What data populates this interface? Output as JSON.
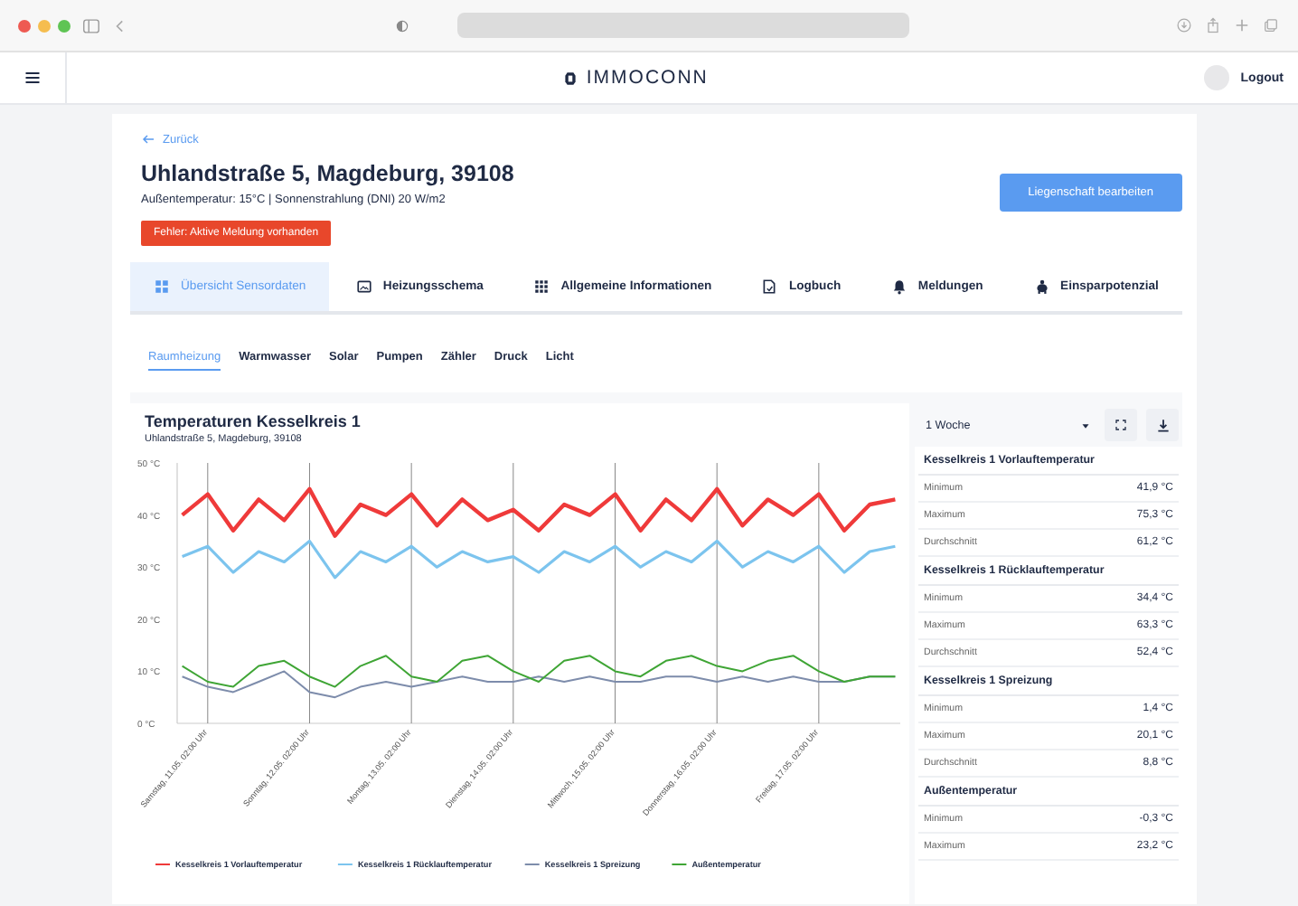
{
  "app": {
    "logo_text": "IMMOCONN",
    "logout": "Logout"
  },
  "page": {
    "back": "Zurück",
    "title": "Uhlandstraße 5, Magdeburg, 39108",
    "subtitle": "Außentemperatur: 15°C | Sonnenstrahlung (DNI) 20 W/m2",
    "alert": "Fehler: Aktive Meldung vorhanden",
    "edit_button": "Liegenschaft bearbeiten"
  },
  "tabs": [
    {
      "label": "Übersicht Sensordaten",
      "kind": "grid",
      "selected": true
    },
    {
      "label": "Heizungsschema",
      "kind": "image",
      "selected": false
    },
    {
      "label": "Allgemeine Informationen",
      "kind": "dots",
      "selected": false
    },
    {
      "label": "Logbuch",
      "kind": "doc",
      "selected": false
    },
    {
      "label": "Meldungen",
      "kind": "bell",
      "selected": false
    },
    {
      "label": "Einsparpotenzial",
      "kind": "piggy",
      "selected": false
    }
  ],
  "subtabs": [
    {
      "label": "Raumheizung",
      "selected": true
    },
    {
      "label": "Warmwasser",
      "selected": false
    },
    {
      "label": "Solar",
      "selected": false
    },
    {
      "label": "Pumpen",
      "selected": false
    },
    {
      "label": "Zähler",
      "selected": false
    },
    {
      "label": "Druck",
      "selected": false
    },
    {
      "label": "Licht",
      "selected": false
    }
  ],
  "chart": {
    "title": "Temperaturen Kesselkreis 1",
    "subtitle": "Uhlandstraße 5, Magdeburg, 39108",
    "range": "1 Woche",
    "chart_data": {
      "type": "line",
      "categories": [
        null,
        "Samstag, 11.05. 02:00 Uhr",
        null,
        null,
        null,
        "Sonntag, 12.05. 02:00 Uhr",
        null,
        null,
        null,
        "Montag, 13.05. 02:00 Uhr",
        null,
        null,
        null,
        "Dienstag, 14.05. 02:00 Uhr",
        null,
        null,
        null,
        "Mittwoch, 15.05. 02:00 Uhr",
        null,
        null,
        null,
        "Donnerstag, 16.05. 02:00 Uhr",
        null,
        null,
        null,
        "Freitag, 17.05. 02:00 Uhr",
        null,
        null,
        null
      ],
      "ylim": [
        0,
        50
      ],
      "grid": true,
      "legend": "bottom",
      "yticks": [
        {
          "value": 0,
          "label": "0 °C"
        },
        {
          "value": 10,
          "label": "10 °C"
        },
        {
          "value": 20,
          "label": "20 °C"
        },
        {
          "value": 30,
          "label": "30 °C"
        },
        {
          "value": 40,
          "label": "40 °C"
        },
        {
          "value": 50,
          "label": "50 °C"
        }
      ],
      "series": [
        {
          "name": "Kesselkreis 1 Vorlauftemperatur",
          "color": "#ef3a3a",
          "values": [
            40,
            44,
            37,
            43,
            39,
            45,
            36,
            42,
            40,
            44,
            38,
            43,
            39,
            41,
            37,
            42,
            40,
            44,
            37,
            43,
            39,
            45,
            38,
            43,
            40,
            44,
            37,
            42,
            43
          ]
        },
        {
          "name": "Kesselkreis 1 Rücklauftemperatur",
          "color": "#7cc4ee",
          "values": [
            32,
            34,
            29,
            33,
            31,
            35,
            28,
            33,
            31,
            34,
            30,
            33,
            31,
            32,
            29,
            33,
            31,
            34,
            30,
            33,
            31,
            35,
            30,
            33,
            31,
            34,
            29,
            33,
            34
          ]
        },
        {
          "name": "Kesselkreis 1 Spreizung",
          "color": "#7d8cab",
          "values": [
            9,
            7,
            6,
            8,
            10,
            6,
            5,
            7,
            8,
            7,
            8,
            9,
            8,
            8,
            9,
            8,
            9,
            8,
            8,
            9,
            9,
            8,
            9,
            8,
            9,
            8,
            8,
            9,
            9
          ]
        },
        {
          "name": "Außentemperatur",
          "color": "#3fa535",
          "values": [
            11,
            8,
            7,
            11,
            12,
            9,
            7,
            11,
            13,
            9,
            8,
            12,
            13,
            10,
            8,
            12,
            13,
            10,
            9,
            12,
            13,
            11,
            10,
            12,
            13,
            10,
            8,
            9,
            9
          ]
        }
      ]
    }
  },
  "stats": [
    {
      "title": "Kesselkreis 1 Vorlauftemperatur",
      "rows": [
        {
          "label": "Minimum",
          "value": "41,9 °C"
        },
        {
          "label": "Maximum",
          "value": "75,3 °C"
        },
        {
          "label": "Durchschnitt",
          "value": "61,2 °C"
        }
      ]
    },
    {
      "title": "Kesselkreis 1 Rücklauftemperatur",
      "rows": [
        {
          "label": "Minimum",
          "value": "34,4 °C"
        },
        {
          "label": "Maximum",
          "value": "63,3 °C"
        },
        {
          "label": "Durchschnitt",
          "value": "52,4 °C"
        }
      ]
    },
    {
      "title": "Kesselkreis 1 Spreizung",
      "rows": [
        {
          "label": "Minimum",
          "value": "1,4 °C"
        },
        {
          "label": "Maximum",
          "value": "20,1 °C"
        },
        {
          "label": "Durchschnitt",
          "value": "8,8 °C"
        }
      ]
    },
    {
      "title": "Außentemperatur",
      "rows": [
        {
          "label": "Minimum",
          "value": "-0,3 °C"
        },
        {
          "label": "Maximum",
          "value": "23,2 °C"
        }
      ]
    }
  ]
}
